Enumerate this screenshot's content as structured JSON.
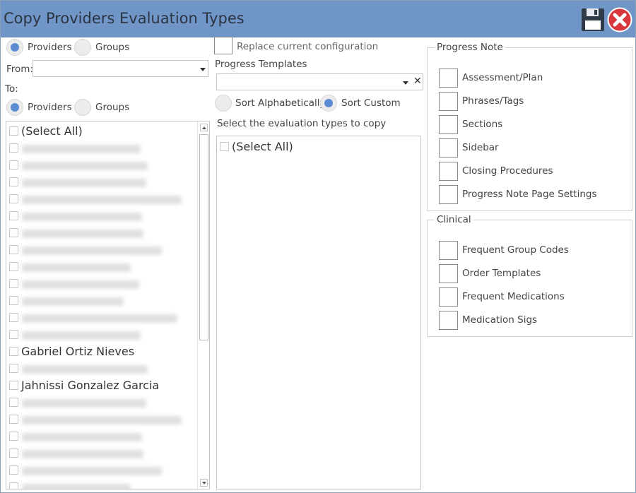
{
  "window": {
    "title": "Copy Providers Evaluation Types"
  },
  "icons": {
    "save": "floppy-disk-icon",
    "close": "close-x-icon",
    "close_color": "#d9363e",
    "accent": "#5b8cd1",
    "titlebar": "#7096c8"
  },
  "source": {
    "type_options": [
      {
        "label": "Providers",
        "selected": true
      },
      {
        "label": "Groups",
        "selected": false
      }
    ],
    "from_label": "From:",
    "from_value": ""
  },
  "target": {
    "to_label": "To:",
    "type_options": [
      {
        "label": "Providers",
        "selected": true
      },
      {
        "label": "Groups",
        "selected": false
      }
    ],
    "list": {
      "select_all": "(Select All)",
      "items": [
        "",
        "",
        "",
        "",
        "",
        "",
        "",
        "",
        "",
        "",
        "",
        "",
        "Gabriel Ortiz Nieves",
        "",
        "Jahnissi Gonzalez Garcia",
        "",
        "",
        "",
        "",
        "",
        "",
        ""
      ]
    }
  },
  "middle": {
    "replace_label": "Replace current configuration",
    "templates_label": "Progress Templates",
    "templates_value": "",
    "sort_options": [
      {
        "label": "Sort Alphabetically",
        "selected": false
      },
      {
        "label": "Sort Custom",
        "selected": true
      }
    ],
    "eval_label": "Select the evaluation types to copy",
    "eval_select_all": "(Select All)"
  },
  "progress_note": {
    "legend": "Progress Note",
    "options": [
      "Assessment/Plan",
      "Phrases/Tags",
      "Sections",
      "Sidebar",
      "Closing Procedures",
      "Progress Note Page Settings"
    ]
  },
  "clinical": {
    "legend": "Clinical",
    "options": [
      "Frequent Group Codes",
      "Order Templates",
      "Frequent Medications",
      "Medication Sigs"
    ]
  }
}
